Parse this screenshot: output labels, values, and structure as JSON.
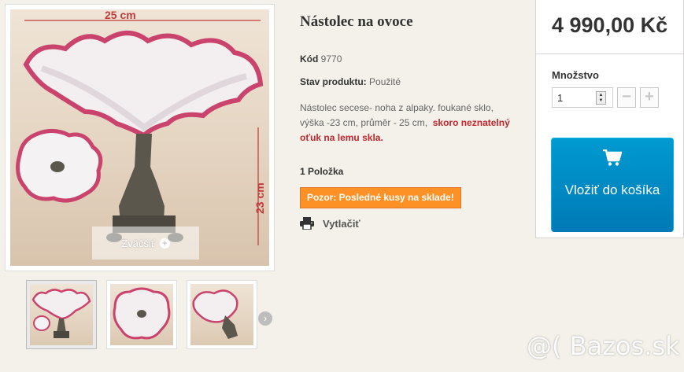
{
  "product": {
    "title": "Nástolec na ovoce",
    "code_label": "Kód",
    "code_value": "9770",
    "condition_label": "Stav produktu:",
    "condition_value": "Použité",
    "description_plain": "Nástolec secese- noha z alpaky. foukané sklo, výška -23 cm, průměr - 25 cm,",
    "description_highlight": "skoro neznatelný oťuk na lemu skla.",
    "quantity_info": "1 Položka",
    "warning": "Pozor: Posledné kusy na sklade!",
    "print_label": "Vytlačiť"
  },
  "gallery": {
    "zoom_label": "Zväčšiť",
    "dimension_width": "25 cm",
    "dimension_height": "23 cm"
  },
  "buybox": {
    "price": "4 990,00 Kč",
    "quantity_label": "Množstvo",
    "quantity_value": "1",
    "minus": "−",
    "plus": "+",
    "add_to_cart": "Vložiť do košíka"
  },
  "watermark": "@( Bazos.sk",
  "colors": {
    "accent_blue": "#0089c6",
    "warning_orange": "#fe9126",
    "highlight_red": "#c0272d"
  },
  "icons": [
    "cart-icon",
    "print-icon",
    "zoom-plus-icon",
    "chevron-right-icon"
  ]
}
